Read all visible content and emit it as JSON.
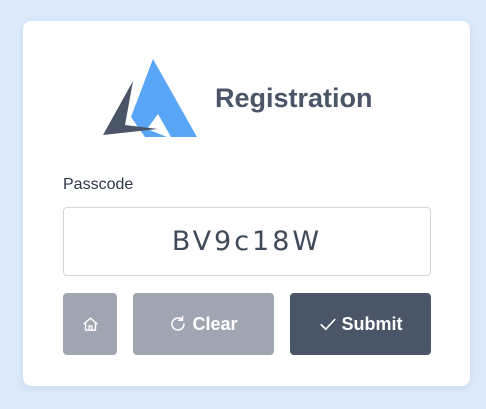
{
  "app": {
    "title": "Registration"
  },
  "form": {
    "passcode_label": "Passcode",
    "passcode_value": "BV9c18W"
  },
  "buttons": {
    "home_icon": "home-icon",
    "clear_icon": "refresh-icon",
    "clear_label": "Clear",
    "submit_icon": "check-icon",
    "submit_label": "Submit"
  },
  "colors": {
    "background": "#dbe9fb",
    "card": "#ffffff",
    "text_dark": "#4a5568",
    "button_disabled": "#a0a6b1",
    "button_primary": "#4a5568",
    "logo_blue": "#58a6f5",
    "logo_dark": "#4a5568"
  }
}
